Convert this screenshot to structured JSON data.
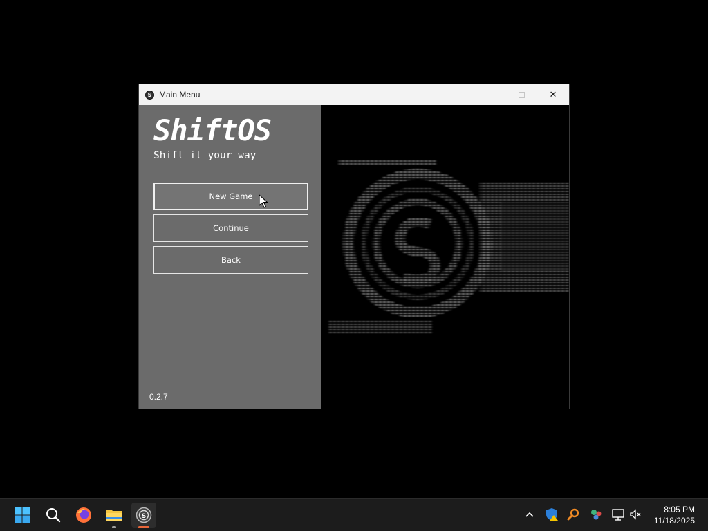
{
  "window": {
    "title": "Main Menu",
    "minimize_glyph": "—",
    "close_glyph": "✕"
  },
  "menu": {
    "brand": "ShiftOS",
    "tagline": "Shift it your way",
    "buttons": [
      {
        "label": "New Game"
      },
      {
        "label": "Continue"
      },
      {
        "label": "Back"
      }
    ],
    "version": "0.2.7"
  },
  "taskbar": {
    "time": "8:05 PM",
    "date": "11/18/2025",
    "accent_color": "#e8663a",
    "icons": [
      "windows-start-icon",
      "search-icon",
      "firefox-icon",
      "file-explorer-icon",
      "shiftos-icon"
    ]
  }
}
